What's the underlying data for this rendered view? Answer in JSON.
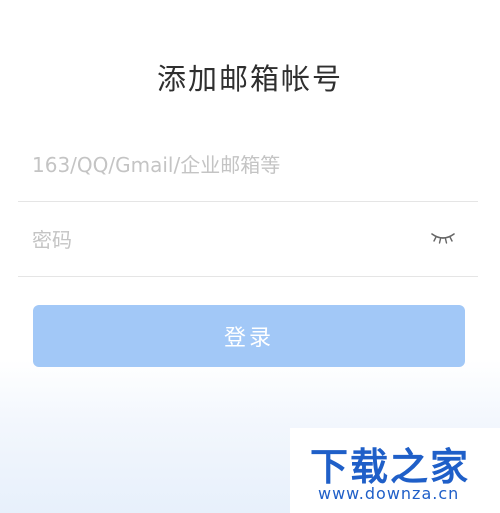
{
  "page": {
    "title": "添加邮箱帐号"
  },
  "form": {
    "email_placeholder": "163/QQ/Gmail/企业邮箱等",
    "email_value": "",
    "password_placeholder": "密码",
    "password_value": "",
    "password_toggle_icon": "eye-closed-icon",
    "login_label": "登录"
  },
  "watermark": {
    "logo_text": "下载之家",
    "url": "www.downza.cn"
  },
  "colors": {
    "login_button": "#a2c8f7",
    "watermark": "#1f5fc8",
    "title_text": "#2f2f2f",
    "placeholder": "#c4c4c4"
  }
}
